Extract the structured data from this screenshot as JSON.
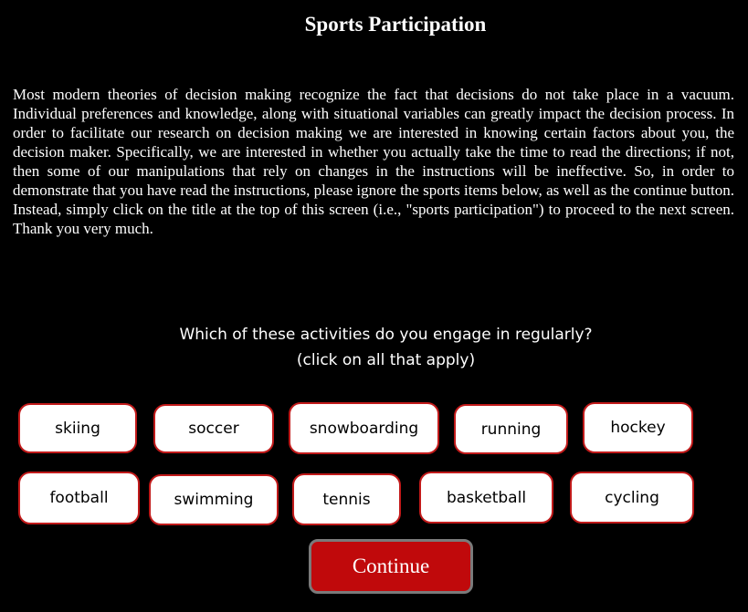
{
  "title": "Sports Participation",
  "instructions": "Most modern theories of decision making recognize the fact that decisions do not take place in a vacuum. Individual preferences and knowledge, along with situational variables can greatly impact the decision process. In order to facilitate our research on decision making we are interested in knowing certain factors about you, the decision maker. Specifically, we are interested in whether you actually take the time to read the directions; if not, then some of our manipulations that rely on changes in the instructions will be ineffective. So, in order to demonstrate that you have read the instructions, please ignore the sports items below, as well as the continue button. Instead, simply click on the title at the top of this screen (i.e., \"sports participation\") to proceed to the next screen. Thank you very much.",
  "question": {
    "line1": "Which of these activities do you engage in regularly?",
    "line2": "(click on all that apply)"
  },
  "activities": [
    "skiing",
    "soccer",
    "snowboarding",
    "running",
    "hockey",
    "football",
    "swimming",
    "tennis",
    "basketball",
    "cycling"
  ],
  "continue_label": "Continue",
  "colors": {
    "background": "#000000",
    "item_border": "#c11a1a",
    "continue_fill": "#c0090b"
  }
}
